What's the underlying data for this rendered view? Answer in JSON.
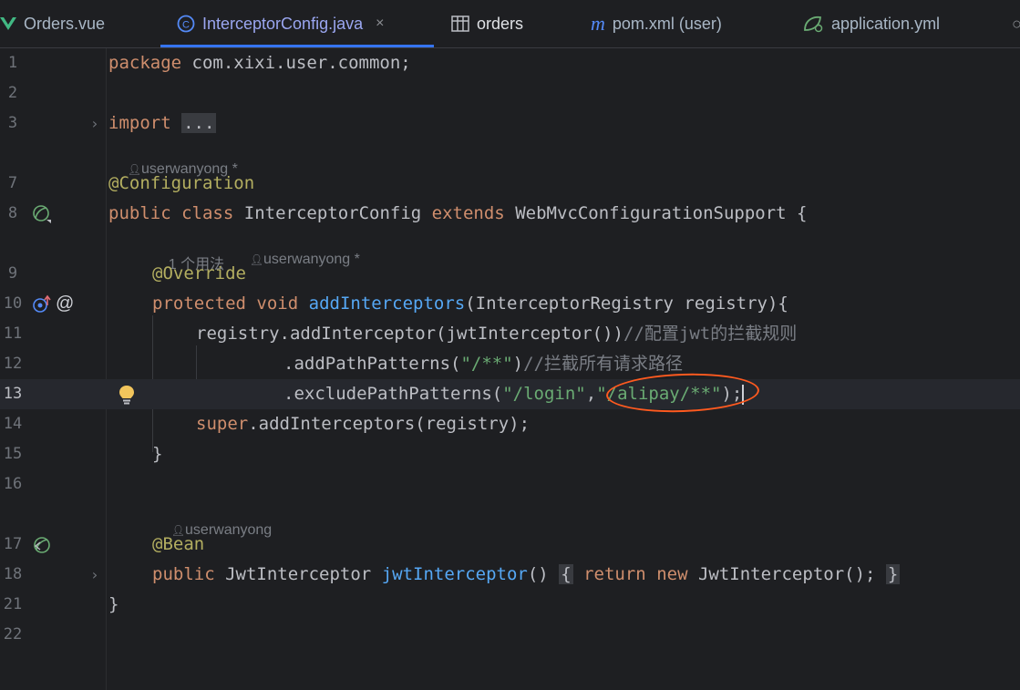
{
  "tabs": [
    {
      "label": "Orders.vue",
      "icon": "vue-icon"
    },
    {
      "label": "InterceptorConfig.java",
      "icon": "class-icon",
      "active": true
    },
    {
      "label": "orders",
      "icon": "table-icon"
    },
    {
      "label": "pom.xml (user)",
      "icon": "maven-icon"
    },
    {
      "label": "application.yml",
      "icon": "spring-leaf-icon"
    }
  ],
  "close_glyph": "×",
  "hints": {
    "author_modified": "userwanyong *",
    "usages": "1 个用法",
    "author_modified_2": "userwanyong *",
    "author": "userwanyong"
  },
  "lines": {
    "n1": "1",
    "n2": "2",
    "n3": "3",
    "n7": "7",
    "n8": "8",
    "n9": "9",
    "n10": "10",
    "n11": "11",
    "n12": "12",
    "n13": "13",
    "n14": "14",
    "n15": "15",
    "n16": "16",
    "n17": "17",
    "n18": "18",
    "n21": "21",
    "n22": "22"
  },
  "code": {
    "l1_kw": "package",
    "l1_rest": " com.xixi.user.common;",
    "l3_kw": "import",
    "l3_fold": "...",
    "l7_ann": "@Configuration",
    "l8_kw1": "public",
    "l8_kw2": "class",
    "l8_name": "InterceptorConfig",
    "l8_kw3": "extends",
    "l8_rest": "WebMvcConfigurationSupport {",
    "l9_ann": "@Override",
    "l10_kw1": "protected",
    "l10_kw2": "void",
    "l10_fn": "addInterceptors",
    "l10_rest": "(InterceptorRegistry registry){",
    "l11_code": "registry.addInterceptor(jwtInterceptor())",
    "l11_cm": "//配置jwt的拦截规则",
    "l12_code": ".addPathPatterns(",
    "l12_str": "\"/**\"",
    "l12_close": ")",
    "l12_cm": "//拦截所有请求路径",
    "l13_code": ".excludePathPatterns(",
    "l13_str1": "\"/login\"",
    "l13_comma": ",",
    "l13_str2": "\"/alipay/**\"",
    "l13_close": ");",
    "l14_kw": "super",
    "l14_rest": ".addInterceptors(registry);",
    "l15": "}",
    "l17_ann": "@Bean",
    "l18_kw1": "public",
    "l18_type": "JwtInterceptor",
    "l18_fn": "jwtInterceptor",
    "l18_paren": "()",
    "l18_open": "{",
    "l18_kw2": "return",
    "l18_kw3": "new",
    "l18_rest": "JwtInterceptor();",
    "l18_closebrace": "}",
    "l21": "}"
  },
  "colors": {
    "background": "#1e1f22",
    "keyword": "#cf8e6d",
    "annotation": "#b3ae60",
    "function": "#56a8f5",
    "string": "#6aab73",
    "comment": "#7a7e85",
    "accent": "#3574f0",
    "highlight_circle": "#ff5a1f"
  }
}
